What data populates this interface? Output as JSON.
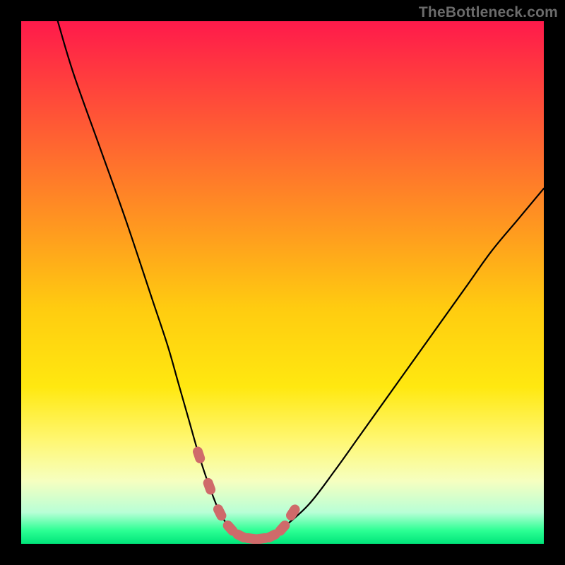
{
  "watermark": "TheBottleneck.com",
  "colors": {
    "frame": "#000000",
    "curve": "#000000",
    "marker_fill": "#cf6a6a",
    "marker_stroke": "#cf6a6a",
    "gradient_stops": [
      {
        "offset": 0.0,
        "color": "#ff1a4b"
      },
      {
        "offset": 0.1,
        "color": "#ff3a3f"
      },
      {
        "offset": 0.25,
        "color": "#ff6a2f"
      },
      {
        "offset": 0.4,
        "color": "#ff9a1f"
      },
      {
        "offset": 0.55,
        "color": "#ffcc10"
      },
      {
        "offset": 0.7,
        "color": "#ffe810"
      },
      {
        "offset": 0.8,
        "color": "#fff770"
      },
      {
        "offset": 0.88,
        "color": "#f6ffc0"
      },
      {
        "offset": 0.94,
        "color": "#b8ffd6"
      },
      {
        "offset": 0.975,
        "color": "#2bff93"
      },
      {
        "offset": 1.0,
        "color": "#00e57a"
      }
    ]
  },
  "chart_data": {
    "type": "line",
    "title": "",
    "xlabel": "",
    "ylabel": "",
    "xlim": [
      0,
      100
    ],
    "ylim": [
      0,
      100
    ],
    "grid": false,
    "legend": false,
    "series": [
      {
        "name": "curve",
        "x": [
          7,
          10,
          15,
          20,
          25,
          28,
          30,
          32,
          34,
          36,
          38,
          40,
          42,
          44,
          46,
          48,
          50,
          55,
          60,
          65,
          70,
          75,
          80,
          85,
          90,
          95,
          100
        ],
        "y": [
          100,
          90,
          76,
          62,
          47,
          38,
          31,
          24,
          17,
          11,
          6,
          3,
          1.5,
          1,
          1,
          1.5,
          3,
          7.5,
          14,
          21,
          28,
          35,
          42,
          49,
          56,
          62,
          68
        ]
      }
    ],
    "markers": {
      "name": "highlighted-range",
      "x": [
        34,
        36,
        38,
        40,
        42,
        44,
        46,
        48,
        50,
        52
      ],
      "y": [
        17,
        11,
        6,
        3,
        1.5,
        1,
        1,
        1.5,
        3,
        6
      ]
    }
  }
}
